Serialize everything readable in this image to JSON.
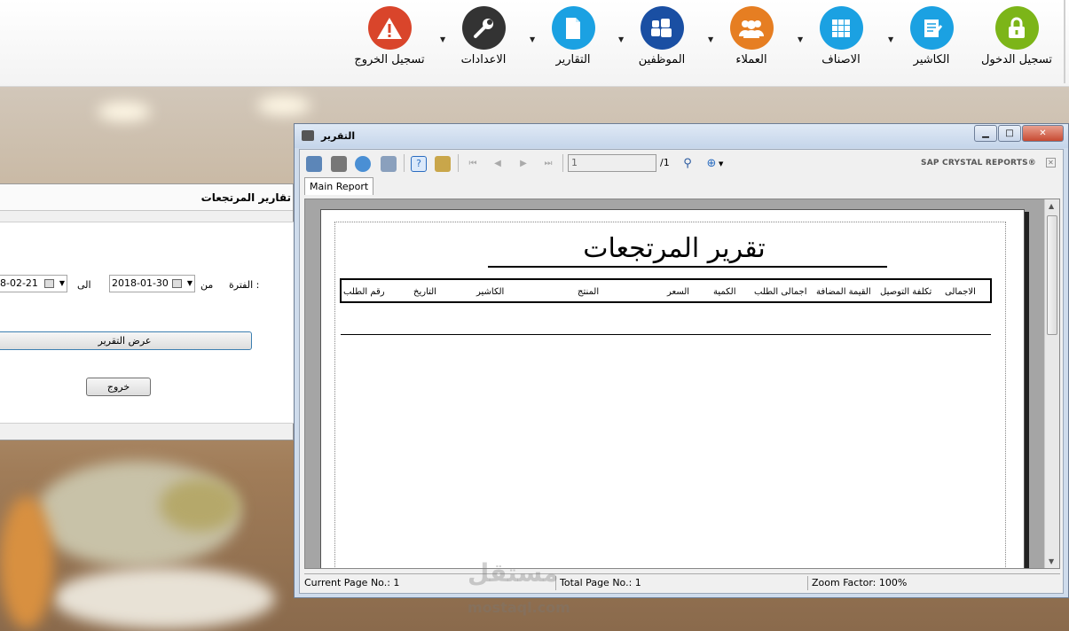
{
  "toolbar": {
    "items": [
      {
        "label": "تسجيل الدخول",
        "icon": "lock-icon",
        "color": "#7cb518"
      },
      {
        "label": "الكاشير",
        "icon": "cashier-icon",
        "color": "#1ba1e2"
      },
      {
        "label": "الاصناف",
        "icon": "grid-icon",
        "color": "#1ba1e2"
      },
      {
        "label": "العملاء",
        "icon": "customers-icon",
        "color": "#e67e22"
      },
      {
        "label": "الموظفين",
        "icon": "employees-icon",
        "color": "#1a4fa3"
      },
      {
        "label": "التقارير",
        "icon": "reports-icon",
        "color": "#1ba1e2"
      },
      {
        "label": "الاعدادات",
        "icon": "wrench-icon",
        "color": "#333333"
      },
      {
        "label": "تسجيل الخروج",
        "icon": "warning-icon",
        "color": "#d9452b"
      }
    ]
  },
  "dialog": {
    "title": "تقارير المرتجعات",
    "period_label": "الفترة :",
    "from_label": "من",
    "to_label": "الى",
    "from_date": "2018-01-30",
    "to_date": "8-02-21",
    "show_button": "عرض التقرير",
    "exit_button": "خروج"
  },
  "report_window": {
    "title": "التقرير",
    "page_input": "1",
    "page_total": "/1",
    "brand": "SAP CRYSTAL REPORTS®",
    "tab": "Main Report",
    "report_title": "تقرير المرتجعات",
    "columns": [
      "الاجمالى",
      "تكلفة التوصيل",
      "القيمة المضافة",
      "اجمالى الطلب",
      "الكمية",
      "السعر",
      "المنتج",
      "الكاشير",
      "التاريخ",
      "رقم الطلب"
    ],
    "status": {
      "current_page": "Current Page No.: 1",
      "total_pages": "Total Page No.: 1",
      "zoom": "Zoom Factor: 100%"
    }
  },
  "watermark": {
    "text": "مستقل",
    "sub": "mostaql.com"
  }
}
